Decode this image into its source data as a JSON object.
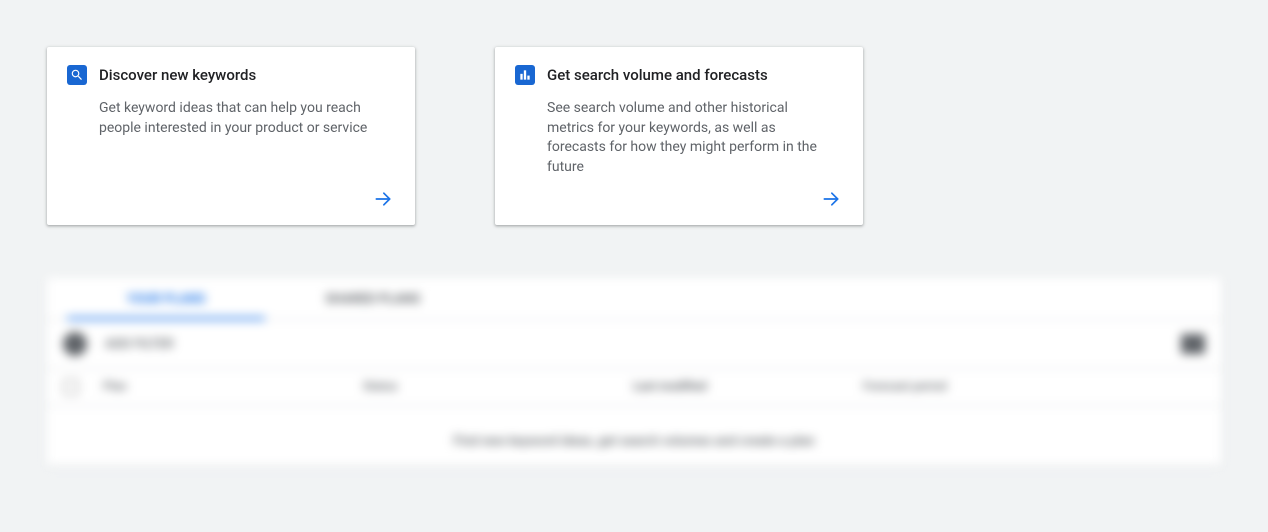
{
  "cards": {
    "discover": {
      "title": "Discover new keywords",
      "description": "Get keyword ideas that can help you reach people interested in your product or service"
    },
    "forecasts": {
      "title": "Get search volume and forecasts",
      "description": "See search volume and other historical metrics for your keywords, as well as forecasts for how they might perform in the future"
    }
  },
  "tabs": {
    "your_plans": "YOUR PLANS",
    "shared_plans": "SHARED PLANS"
  },
  "filter": {
    "add_filter": "ADD FILTER",
    "columns": "COLUMNS"
  },
  "table": {
    "headers": {
      "plan": "Plan",
      "status": "Status",
      "last_modified": "Last modified",
      "forecast_period": "Forecast period"
    },
    "empty_message": "Find new keyword ideas, get search volumes and create a plan"
  }
}
